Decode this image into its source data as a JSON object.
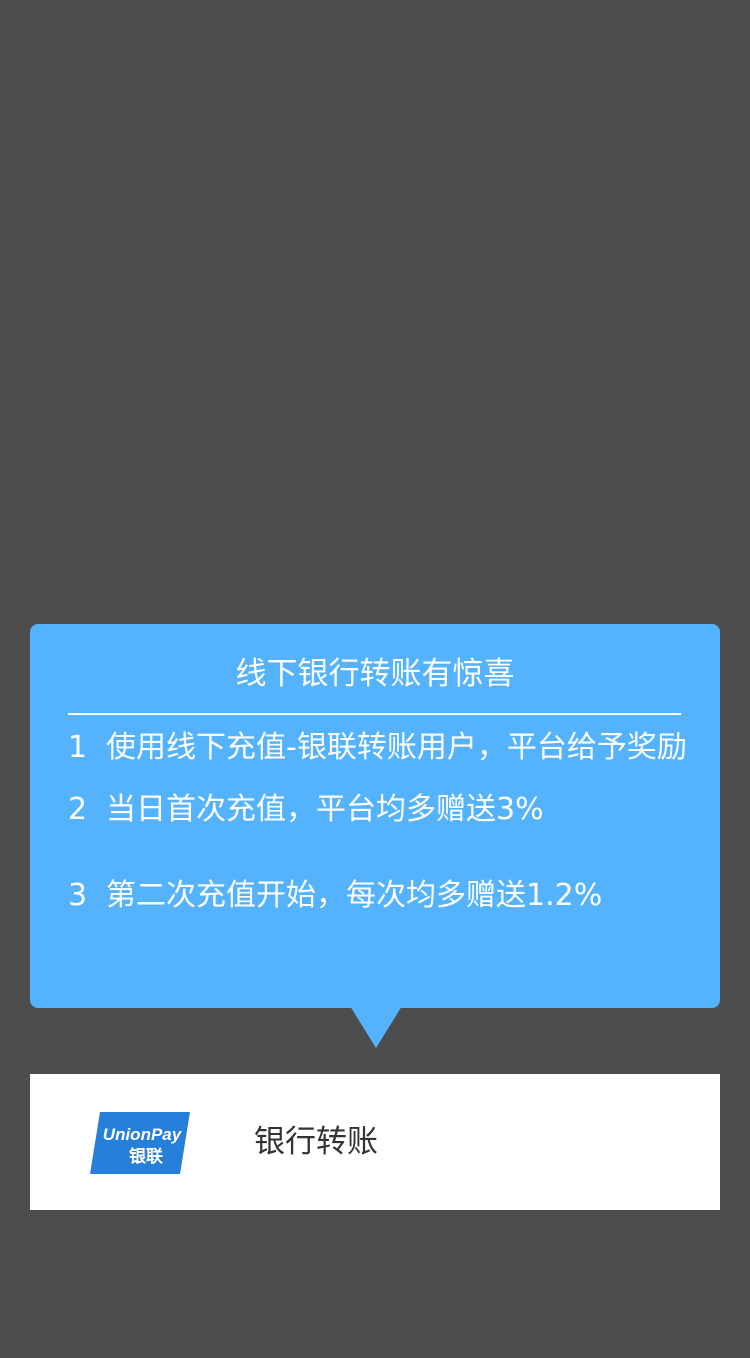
{
  "promo": {
    "title": "线下银行转账有惊喜",
    "items": [
      {
        "num": "1",
        "text": "使用线下充值-银联转账用户，平台给予奖励"
      },
      {
        "num": "2",
        "text": "当日首次充值，平台均多赠送3%"
      },
      {
        "num": "3",
        "text": "第二次充值开始，每次均多赠送1.2%"
      }
    ]
  },
  "payment_option": {
    "label": "银行转账",
    "logo_text_top": "UnionPay",
    "logo_text_bottom": "银联",
    "logo_icon": "unionpay-logo-icon"
  },
  "colors": {
    "background": "#4d4d4d",
    "tooltip": "#55b2fd",
    "card": "#ffffff",
    "logo_blue": "#2680d9"
  }
}
